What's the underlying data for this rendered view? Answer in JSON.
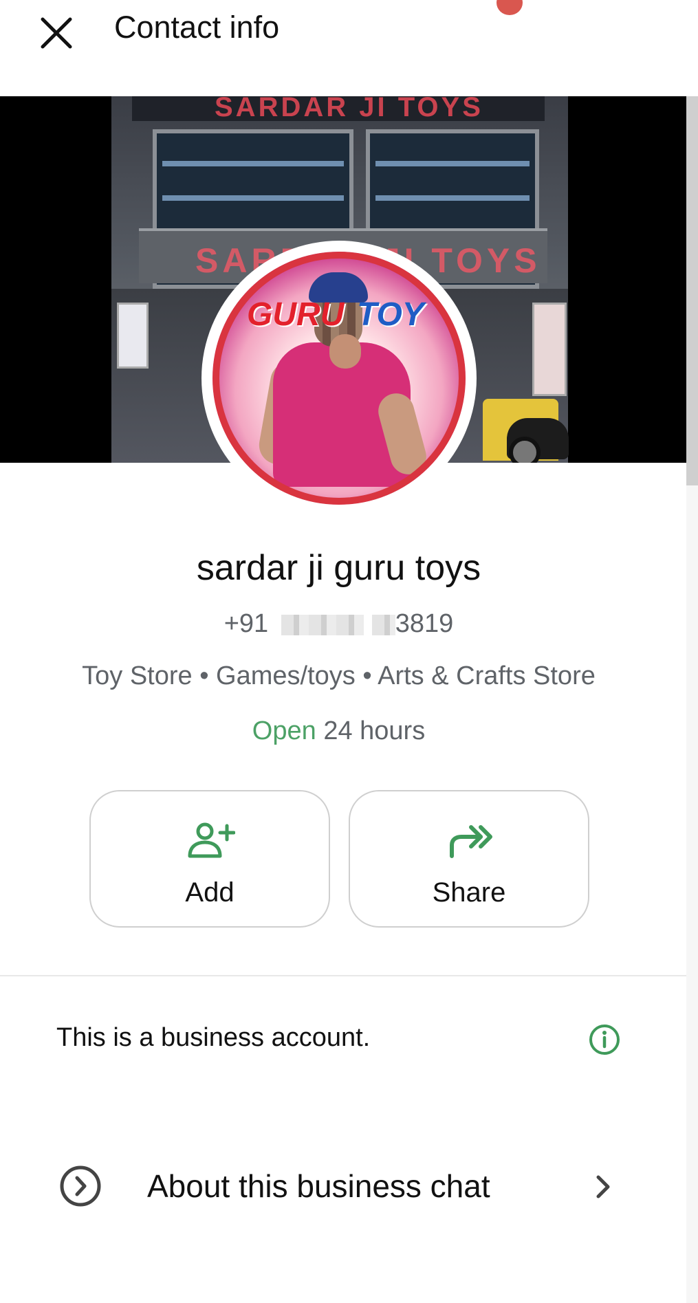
{
  "header": {
    "title": "Contact info",
    "close_icon": "close-icon"
  },
  "cover": {
    "sign_top": "SARDAR JI TOYS",
    "sign_main": "SARDAR JI TOYS"
  },
  "avatar": {
    "logo_left": "GURU",
    "logo_right": "TOY"
  },
  "profile": {
    "name": "sardar ji guru toys",
    "phone_prefix": "+91",
    "phone_suffix": "3819",
    "categories": "Toy Store • Games/toys • Arts & Crafts Store",
    "open_label": "Open",
    "hours_label": "24 hours"
  },
  "actions": {
    "add_label": "Add",
    "share_label": "Share",
    "add_icon": "add-person-icon",
    "share_icon": "share-forward-icon"
  },
  "business": {
    "text": "This is a business account.",
    "info_icon": "info-icon"
  },
  "about": {
    "label": "About this business chat",
    "icon": "chevron-circle-icon",
    "chevron": "chevron-right-icon"
  },
  "colors": {
    "accent_green": "#4ca166",
    "icon_green": "#3f9a5a",
    "notification_red": "#d9574f"
  }
}
